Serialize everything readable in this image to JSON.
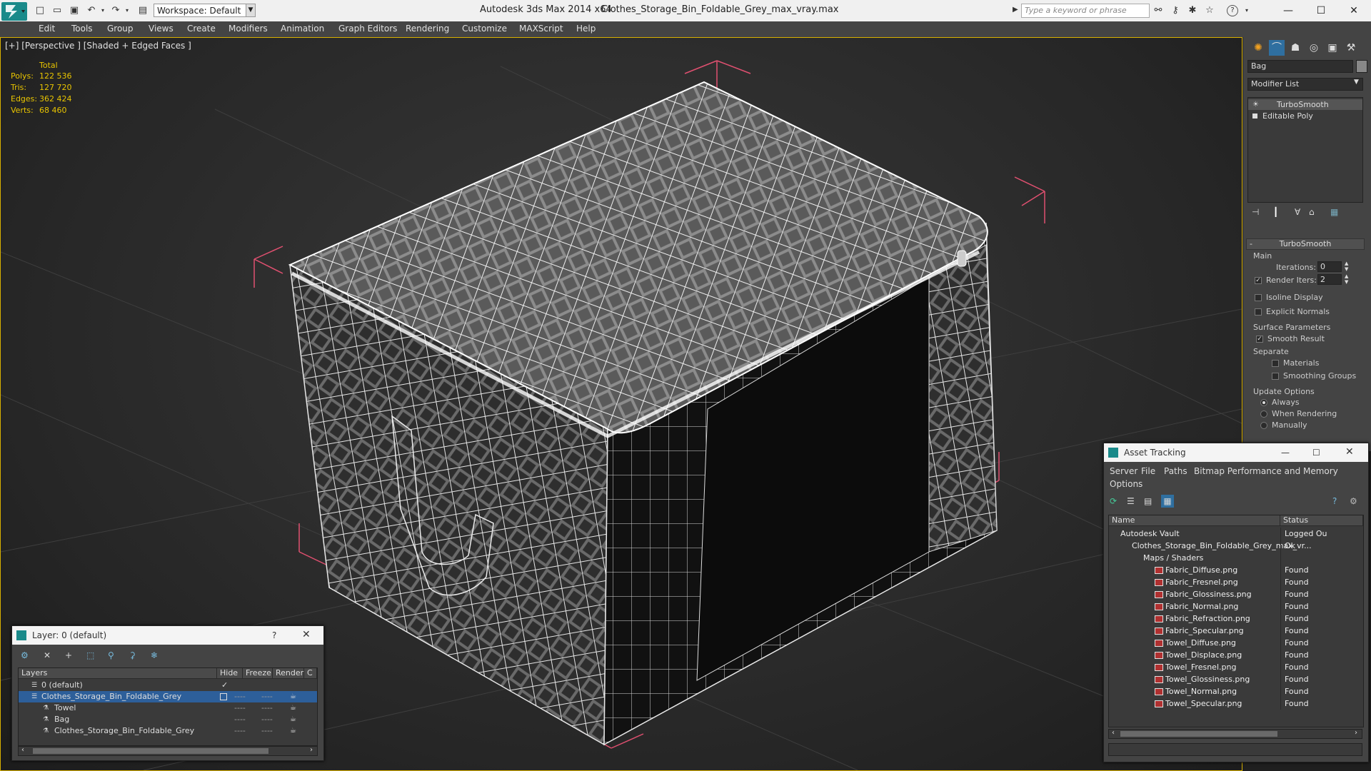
{
  "titlebar": {
    "workspace": "Workspace: Default",
    "app_title": "Autodesk 3ds Max  2014 x64",
    "file_title": "Clothes_Storage_Bin_Foldable_Grey_max_vray.max",
    "search_placeholder": "Type a keyword or phrase"
  },
  "menu": [
    "Edit",
    "Tools",
    "Group",
    "Views",
    "Create",
    "Modifiers",
    "Animation",
    "Graph Editors",
    "Rendering",
    "Customize",
    "MAXScript",
    "Help"
  ],
  "viewport": {
    "label": "[+] [Perspective ] [Shaded + Edged Faces ]",
    "stats": {
      "header": "Total",
      "rows": [
        {
          "label": "Polys:",
          "value": "122 536"
        },
        {
          "label": "Tris:",
          "value": "127 720"
        },
        {
          "label": "Edges:",
          "value": "362 424"
        },
        {
          "label": "Verts:",
          "value": "68 460"
        }
      ]
    }
  },
  "command_panel": {
    "object_name": "Bag",
    "modifier_list": "Modifier List",
    "stack": [
      "TurboSmooth",
      "Editable Poly"
    ],
    "rollout_title": "TurboSmooth",
    "main_label": "Main",
    "iterations_label": "Iterations:",
    "iterations_value": "0",
    "render_iters_label": "Render Iters:",
    "render_iters_value": "2",
    "isoline": "Isoline Display",
    "explicit_normals": "Explicit Normals",
    "surface_params": "Surface Parameters",
    "smooth_result": "Smooth Result",
    "separate": "Separate",
    "materials": "Materials",
    "smoothing_groups": "Smoothing Groups",
    "update_options": "Update Options",
    "always": "Always",
    "when_rendering": "When Rendering",
    "manually": "Manually"
  },
  "layer_dialog": {
    "title": "Layer: 0 (default)",
    "help": "?",
    "columns": [
      "Layers",
      "Hide",
      "Freeze",
      "Render",
      "C"
    ],
    "rows": [
      {
        "name": "0 (default)",
        "indent": 0
      },
      {
        "name": "Clothes_Storage_Bin_Foldable_Grey",
        "indent": 0
      },
      {
        "name": "Towel",
        "indent": 1
      },
      {
        "name": "Bag",
        "indent": 1
      },
      {
        "name": "Clothes_Storage_Bin_Foldable_Grey",
        "indent": 1
      }
    ],
    "dash": "----"
  },
  "asset_dialog": {
    "title": "Asset Tracking",
    "menus": [
      "Server",
      "File",
      "Paths",
      "Bitmap Performance and Memory",
      "Options"
    ],
    "columns": [
      "Name",
      "Status"
    ],
    "rows": [
      {
        "name": "Autodesk Vault",
        "status": "Logged Ou",
        "level": 0
      },
      {
        "name": "Clothes_Storage_Bin_Foldable_Grey_max_vr...",
        "status": "Ok",
        "level": 1
      },
      {
        "name": "Maps / Shaders",
        "status": "",
        "level": 2
      },
      {
        "name": "Fabric_Diffuse.png",
        "status": "Found",
        "level": 3
      },
      {
        "name": "Fabric_Fresnel.png",
        "status": "Found",
        "level": 3
      },
      {
        "name": "Fabric_Glossiness.png",
        "status": "Found",
        "level": 3
      },
      {
        "name": "Fabric_Normal.png",
        "status": "Found",
        "level": 3
      },
      {
        "name": "Fabric_Refraction.png",
        "status": "Found",
        "level": 3
      },
      {
        "name": "Fabric_Specular.png",
        "status": "Found",
        "level": 3
      },
      {
        "name": "Towel_Diffuse.png",
        "status": "Found",
        "level": 3
      },
      {
        "name": "Towel_Displace.png",
        "status": "Found",
        "level": 3
      },
      {
        "name": "Towel_Fresnel.png",
        "status": "Found",
        "level": 3
      },
      {
        "name": "Towel_Glossiness.png",
        "status": "Found",
        "level": 3
      },
      {
        "name": "Towel_Normal.png",
        "status": "Found",
        "level": 3
      },
      {
        "name": "Towel_Specular.png",
        "status": "Found",
        "level": 3
      }
    ]
  }
}
